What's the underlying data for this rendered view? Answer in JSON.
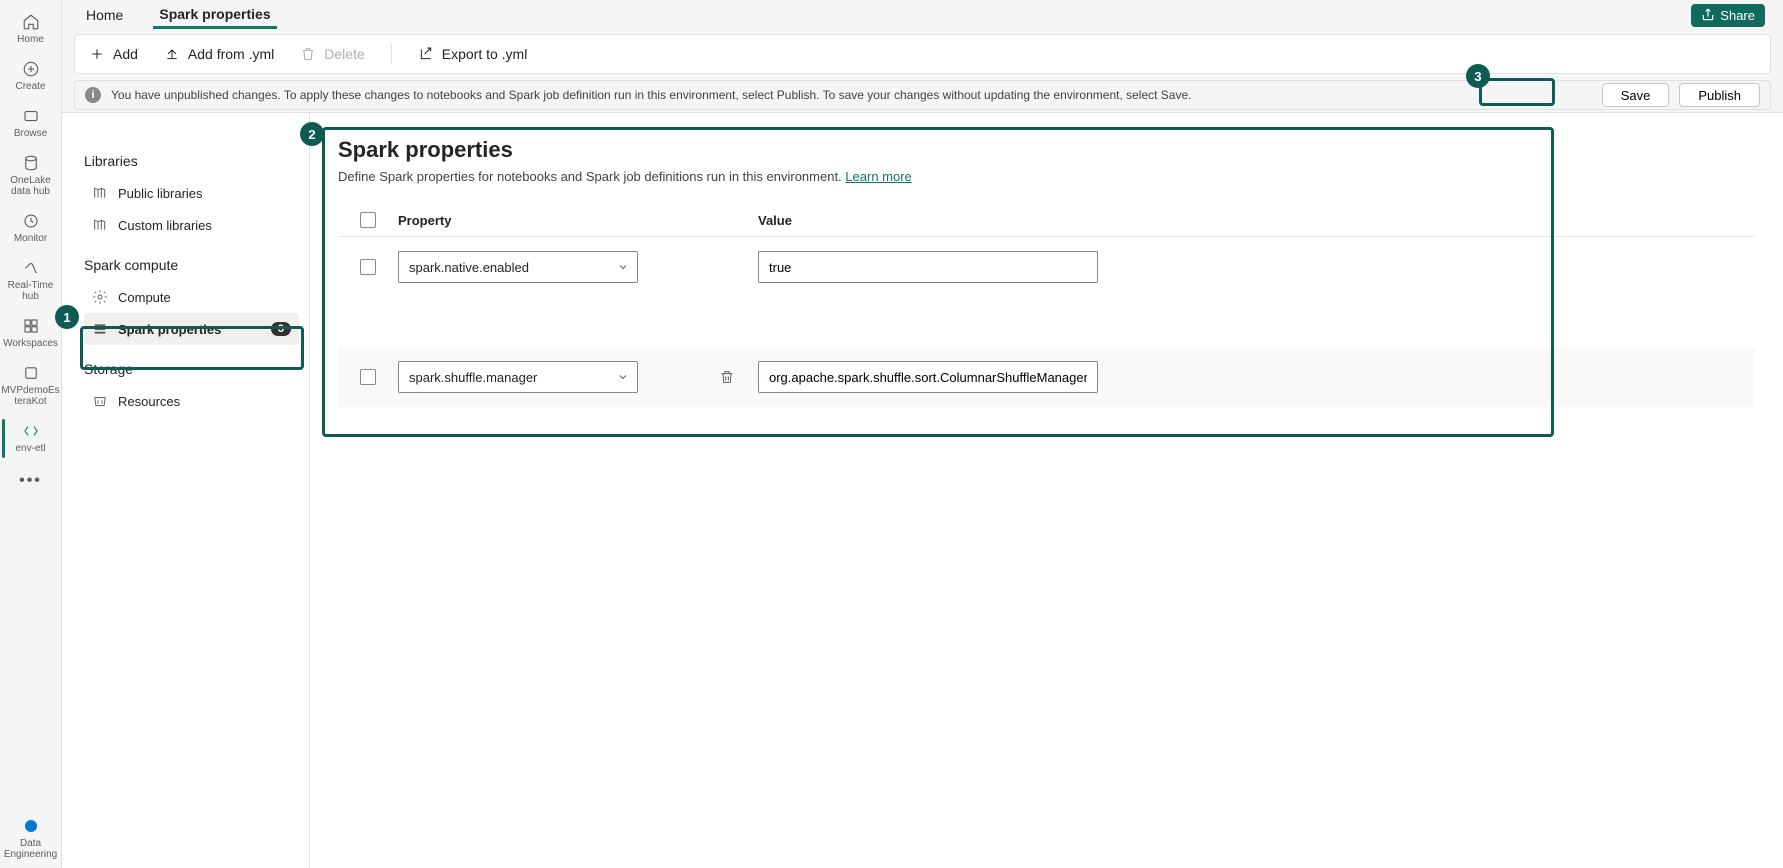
{
  "rail": {
    "home": "Home",
    "create": "Create",
    "browse": "Browse",
    "onelake": "OneLake data hub",
    "monitor": "Monitor",
    "realtime": "Real-Time hub",
    "workspaces": "Workspaces",
    "ws_item": "MVPdemoEs teraKot",
    "env_item": "env-etl",
    "data_eng": "Data Engineering"
  },
  "tabs": {
    "home": "Home",
    "spark": "Spark properties"
  },
  "share": "Share",
  "toolbar": {
    "add": "Add",
    "add_yml": "Add from .yml",
    "delete": "Delete",
    "export_yml": "Export to .yml"
  },
  "banner": {
    "text": "You have unpublished changes. To apply these changes to notebooks and Spark job definition run in this environment, select Publish. To save your changes without updating the environment, select Save.",
    "save": "Save",
    "publish": "Publish"
  },
  "sidebar": {
    "libraries": "Libraries",
    "public": "Public libraries",
    "custom": "Custom libraries",
    "spark_compute": "Spark compute",
    "compute": "Compute",
    "spark_props": "Spark properties",
    "spark_props_badge": "3",
    "storage": "Storage",
    "resources": "Resources"
  },
  "main": {
    "title": "Spark properties",
    "desc": "Define Spark properties for notebooks and Spark job definitions run in this environment. ",
    "learn": "Learn more",
    "col_property": "Property",
    "col_value": "Value"
  },
  "rows": [
    {
      "property": "spark.native.enabled",
      "value": "true"
    },
    {
      "property": "spark.shuffle.manager",
      "value": "org.apache.spark.shuffle.sort.ColumnarShuffleManager"
    }
  ],
  "callouts": {
    "one": "1",
    "two": "2",
    "three": "3"
  }
}
